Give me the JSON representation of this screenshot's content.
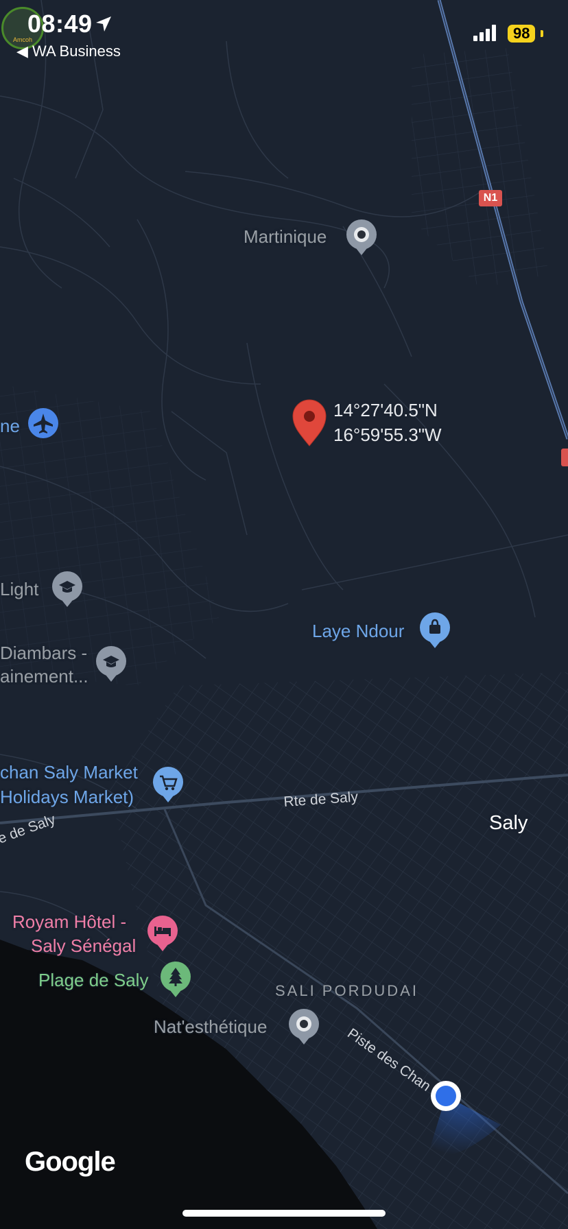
{
  "status_bar": {
    "time": "08:49",
    "back_label": "WA Business",
    "battery": "98",
    "logo_text": "Amcoh"
  },
  "map": {
    "pin_coordinates": {
      "lat": "14°27'40.5\"N",
      "lng": "16°59'55.3\"W"
    },
    "road_shield": "N1",
    "roads": {
      "rte_de_saly": "Rte de Saly",
      "rte_de_saly_west": "e de Saly",
      "piste": "Piste des Chan"
    },
    "places": {
      "martinique": "Martinique",
      "airport_partial": "ne",
      "light": "Light",
      "diambars_line1": "Diambars -",
      "diambars_line2": "ainement...",
      "laye_ndour": "Laye Ndour",
      "market_line1": "chan Saly Market",
      "market_line2": "Holidays Market)",
      "saly": "Saly",
      "royam_line1": "Royam Hôtel -",
      "royam_line2": "Saly Sénégal",
      "plage": "Plage de Saly",
      "sali_porudai": "SALI PORDUDAI",
      "natesthetique": "Nat'esthétique"
    },
    "icons": {
      "pin": "red-location-pin-icon",
      "martinique": "gray-place-icon",
      "airport": "airplane-icon",
      "school": "graduation-cap-icon",
      "shopping": "shopping-bag-icon",
      "market": "shopping-cart-icon",
      "hotel": "bed-icon",
      "park": "tree-icon",
      "place": "gray-place-icon",
      "current_location": "blue-dot-icon"
    },
    "colors": {
      "land": "#1b2330",
      "sea": "#0b0d10",
      "road": "#2e3848",
      "highway": "#5a7bb0",
      "pin": "#e0473b",
      "current_location": "#2f6fe8"
    },
    "attribution": "Google"
  }
}
